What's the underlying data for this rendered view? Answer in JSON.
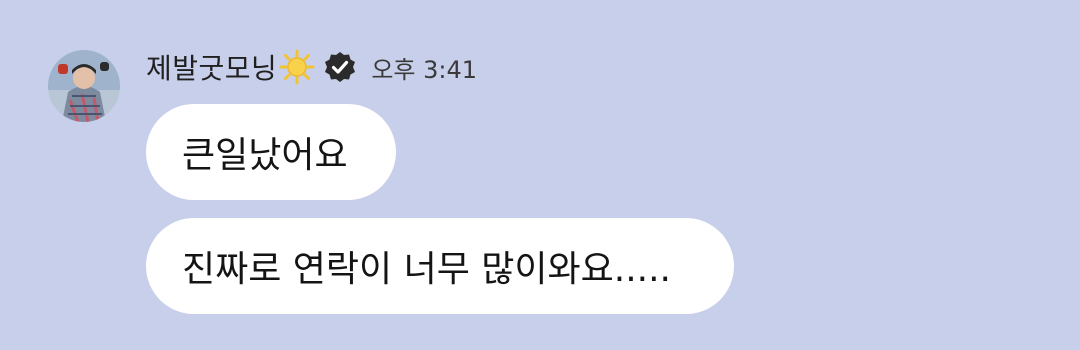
{
  "message_group": {
    "sender_name": "제발굿모닝",
    "sun_emoji": "sun-icon",
    "verified_badge": "verified-check-icon",
    "timestamp": "오후 3:41",
    "messages": [
      {
        "text": "큰일났어요"
      },
      {
        "text": "진짜로 연락이 너무 많이와요....."
      }
    ]
  },
  "colors": {
    "background": "#c8cfea",
    "bubble": "#ffffff",
    "text": "#141414"
  }
}
